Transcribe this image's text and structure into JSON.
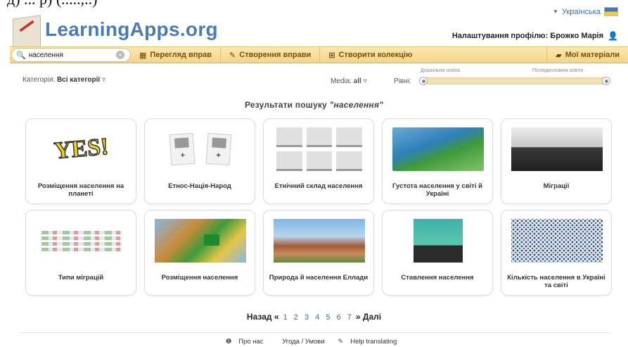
{
  "cropped_top_text": "д) ... р) (.....,..)",
  "header": {
    "logo": "LearningApps.org",
    "language": "Українська",
    "profile_label": "Налаштування профілю: Брожко Марія"
  },
  "navbar": {
    "search_value": "населення",
    "browse": "Перегляд вправ",
    "create_app": "Створення вправи",
    "create_collection": "Створити колекцію",
    "my_materials": "Мої матеріали"
  },
  "filters": {
    "category_label": "Категорія:",
    "category_value": "Всі категорії",
    "media_label": "Media:",
    "media_value": "all",
    "level_label": "Рівні:",
    "level_min": "Дошкільна освіта",
    "level_max": "Післядипломна освіта"
  },
  "results": {
    "prefix": "Результати пошуку",
    "query": "\"населення\""
  },
  "cards": [
    {
      "title": "Розміщення населення на планеті"
    },
    {
      "title": "Етнос-Нація-Народ"
    },
    {
      "title": "Етнічний склад населення"
    },
    {
      "title": "Густота населення у світі й Україні"
    },
    {
      "title": "Міграції"
    },
    {
      "title": "Типи міграцій"
    },
    {
      "title": "Розміщення населення"
    },
    {
      "title": "Природа й населення Еллади"
    },
    {
      "title": "Ставлення населення"
    },
    {
      "title": "Кількість населення в Україні та світі"
    }
  ],
  "thumb_text": {
    "yes": "YES!"
  },
  "pagination": {
    "prev": "Назад «",
    "pages": [
      "1",
      "2",
      "3",
      "4",
      "5",
      "6",
      "7"
    ],
    "next": "» Далі"
  },
  "footer": {
    "about": "Про нас",
    "terms": "Угода / Умови",
    "help": "Help translating"
  },
  "icons": {
    "search": "search-icon",
    "grid": "grid-icon",
    "pencil": "pencil-icon",
    "collection": "collection-icon",
    "folder": "folder-icon",
    "user": "user-icon",
    "info": "info-icon",
    "flag": "flag-ukraine-icon"
  },
  "colors": {
    "logo_blue": "#4a7ab8",
    "navbar": "#f3d58a",
    "nav_text": "#7a4c0a"
  }
}
